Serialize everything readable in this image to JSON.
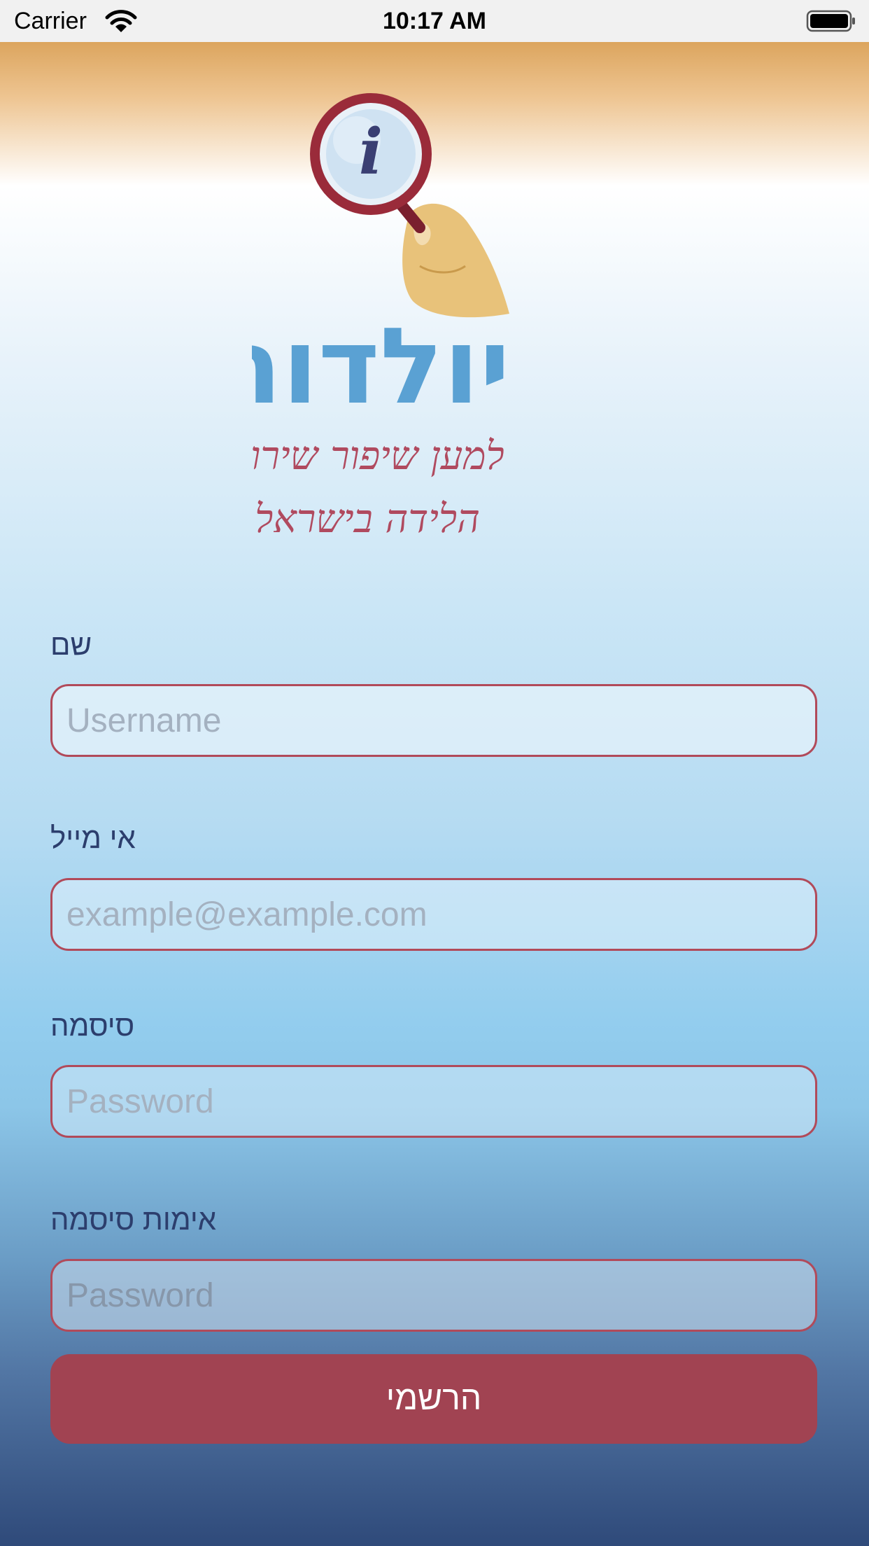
{
  "status_bar": {
    "carrier": "Carrier",
    "time": "10:17 AM",
    "icons": [
      "wifi-icon",
      "battery-icon"
    ]
  },
  "logo": {
    "brand_name": "יולדות",
    "tagline_line1": "למען שיפור שירותי",
    "tagline_line2": "הלידה בישראל",
    "icon": "magnifier-info-icon"
  },
  "form": {
    "name": {
      "label": "שם",
      "placeholder": "Username"
    },
    "email": {
      "label": "אי מייל",
      "placeholder": "example@example.com"
    },
    "password": {
      "label": "סיסמה",
      "placeholder": "Password"
    },
    "confirm_password": {
      "label": "אימות סיסמה",
      "placeholder": "Password"
    },
    "submit_label": "הרשמי"
  },
  "colors": {
    "accent": "#a14352",
    "field_border": "#b14a5a",
    "label_text": "#2c3e6d"
  }
}
